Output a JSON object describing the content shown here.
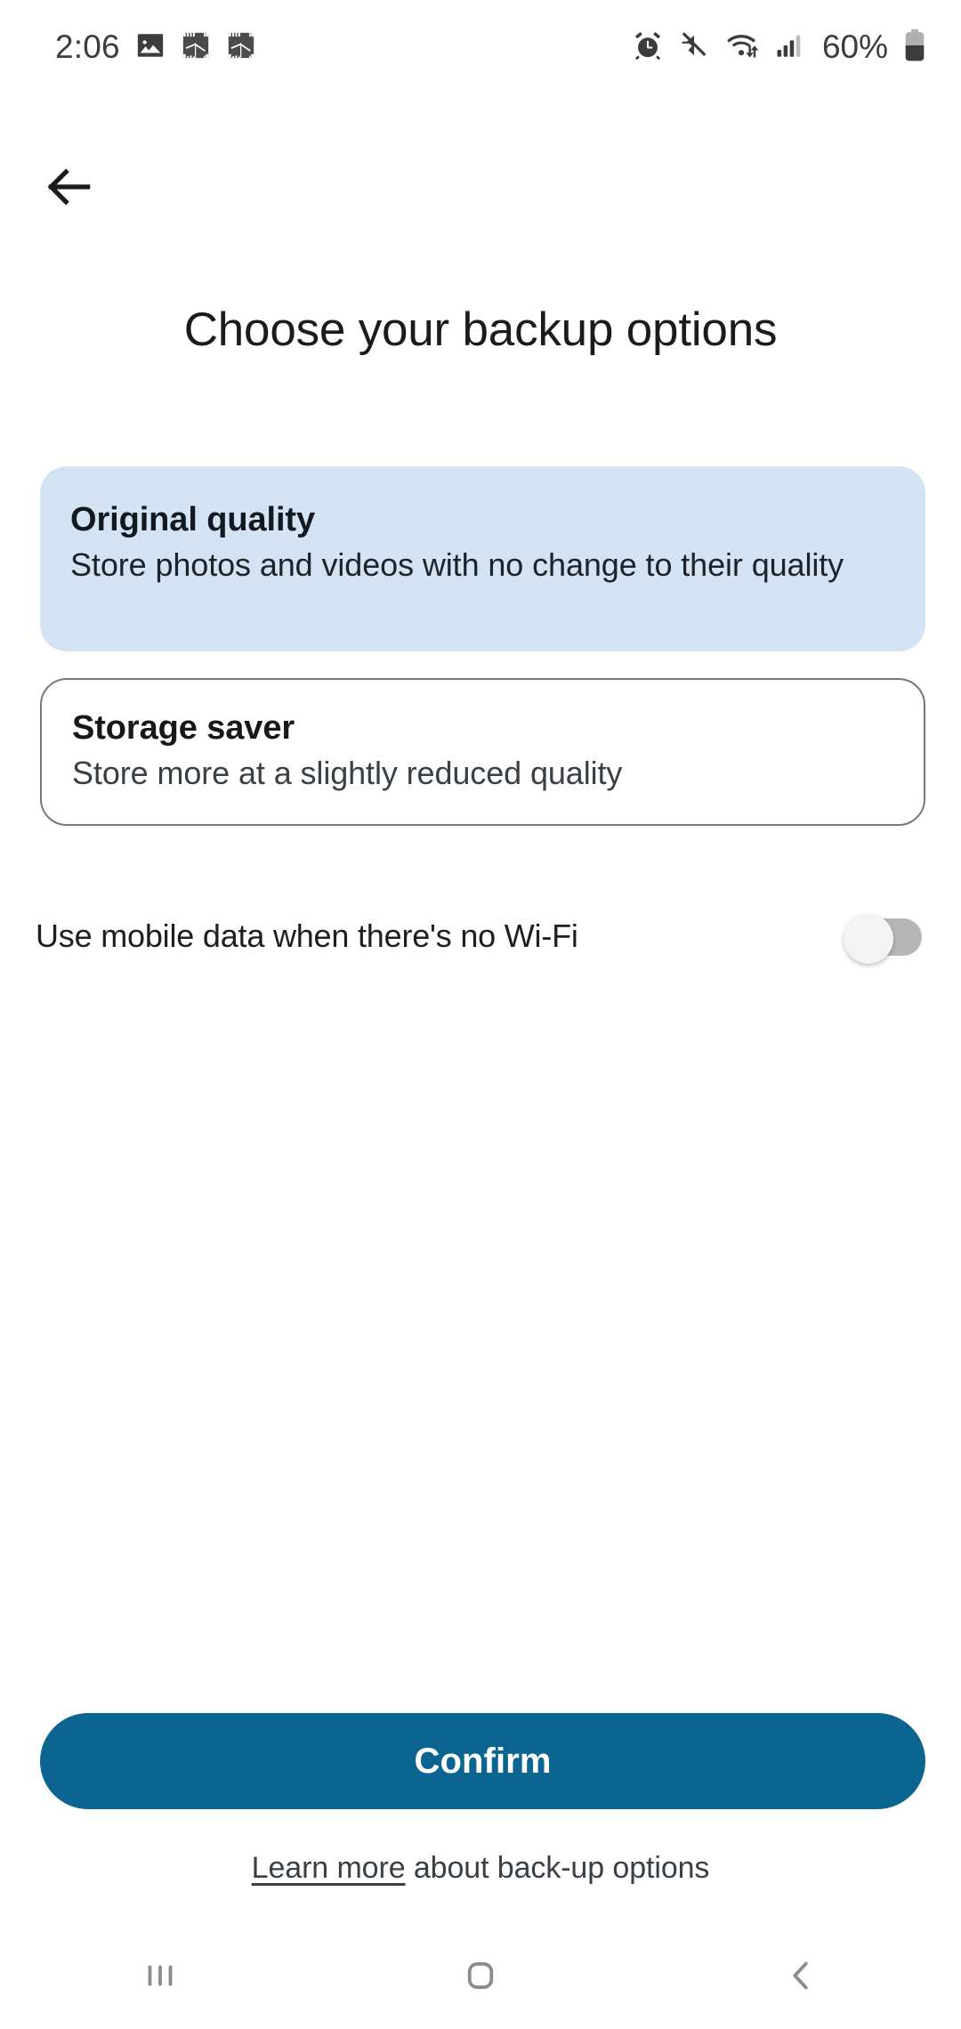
{
  "status_bar": {
    "time": "2:06",
    "battery_percent": "60%",
    "left_icons": [
      "photo-icon",
      "screenshot-icon",
      "screenshot-icon"
    ],
    "right_icons": [
      "alarm-icon",
      "mute-icon",
      "wifi-icon",
      "signal-icon",
      "battery-icon"
    ]
  },
  "appbar": {
    "back_icon": "back-arrow-icon"
  },
  "header": {
    "title": "Choose your backup options"
  },
  "options": [
    {
      "title": "Original quality",
      "description": "Store photos and videos with no change to their quality",
      "selected": true
    },
    {
      "title": "Storage saver",
      "description": "Store more at a slightly reduced quality",
      "selected": false
    }
  ],
  "mobile_data": {
    "label": "Use mobile data when there's no Wi-Fi",
    "enabled": false
  },
  "footer": {
    "confirm_label": "Confirm",
    "learn_more_link": "Learn more",
    "learn_more_rest": " about back-up options"
  },
  "nav_bar": {
    "recents_icon": "recents-icon",
    "home_icon": "home-icon",
    "back_icon": "back-chevron-icon"
  },
  "colors": {
    "selected_card_bg": "#d3e3f4",
    "card_border": "#76797c",
    "confirm_bg": "#0c6590",
    "page_bg": "#ffffff",
    "status_icon": "#3c3c3c",
    "nav_icon": "#8c8c8c"
  }
}
